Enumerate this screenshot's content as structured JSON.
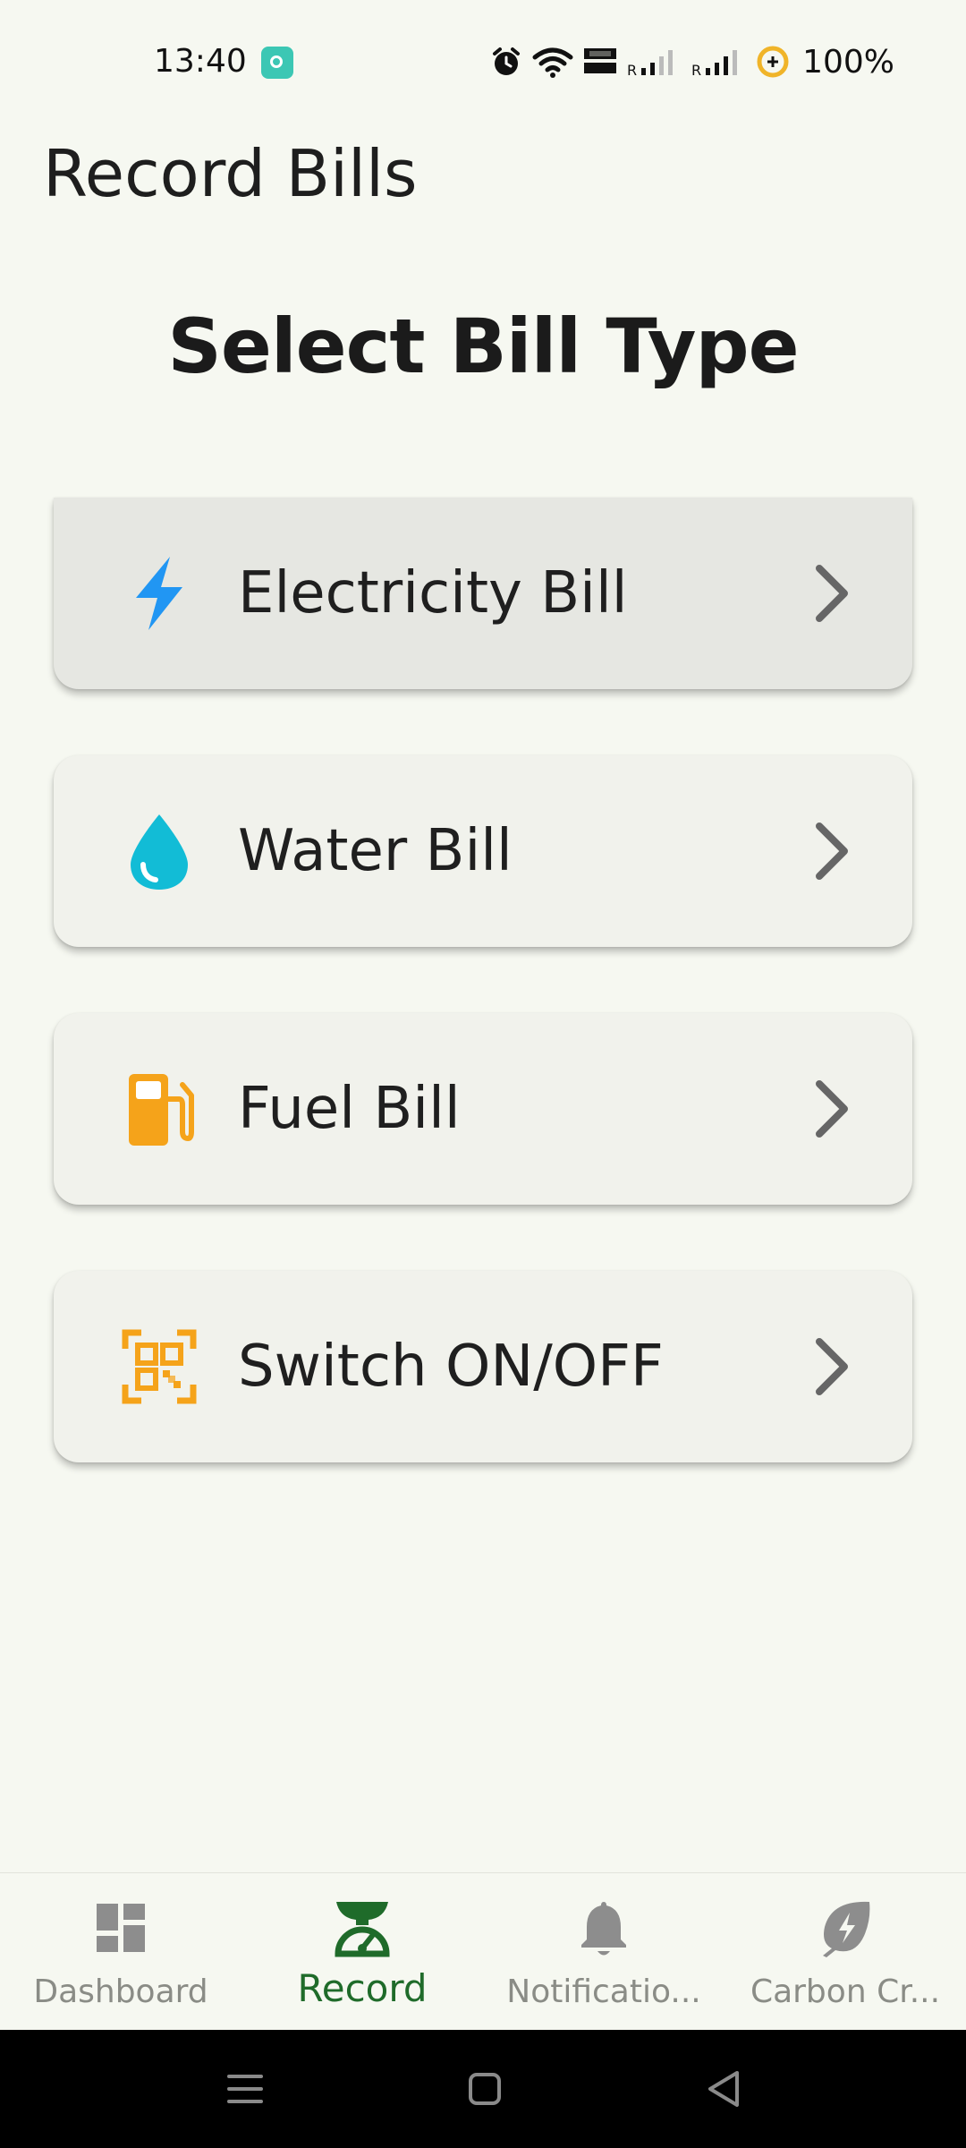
{
  "status_bar": {
    "time": "13:40",
    "battery": "100%",
    "icons": [
      "alarm-icon",
      "wifi-icon",
      "volte-icon",
      "signal-1-icon",
      "signal-2-icon",
      "battery-saver-icon"
    ]
  },
  "header": {
    "title": "Record Bills"
  },
  "main": {
    "section_title": "Select Bill Type",
    "options": [
      {
        "label": "Electricity Bill",
        "icon": "lightning-icon",
        "icon_color": "#2196f3"
      },
      {
        "label": "Water Bill",
        "icon": "water-drop-icon",
        "icon_color": "#12bcd6"
      },
      {
        "label": "Fuel Bill",
        "icon": "fuel-pump-icon",
        "icon_color": "#f5a31a"
      },
      {
        "label": "Switch ON/OFF",
        "icon": "qr-scan-icon",
        "icon_color": "#f5a31a"
      }
    ]
  },
  "bottom_nav": {
    "active": "Record",
    "active_color": "#1f6b2a",
    "items": [
      {
        "label": "Dashboard",
        "icon": "dashboard-icon"
      },
      {
        "label": "Record",
        "icon": "scale-icon"
      },
      {
        "label": "Notificatio...",
        "icon": "bell-icon"
      },
      {
        "label": "Carbon Cr...",
        "icon": "carbon-leaf-icon"
      }
    ]
  }
}
